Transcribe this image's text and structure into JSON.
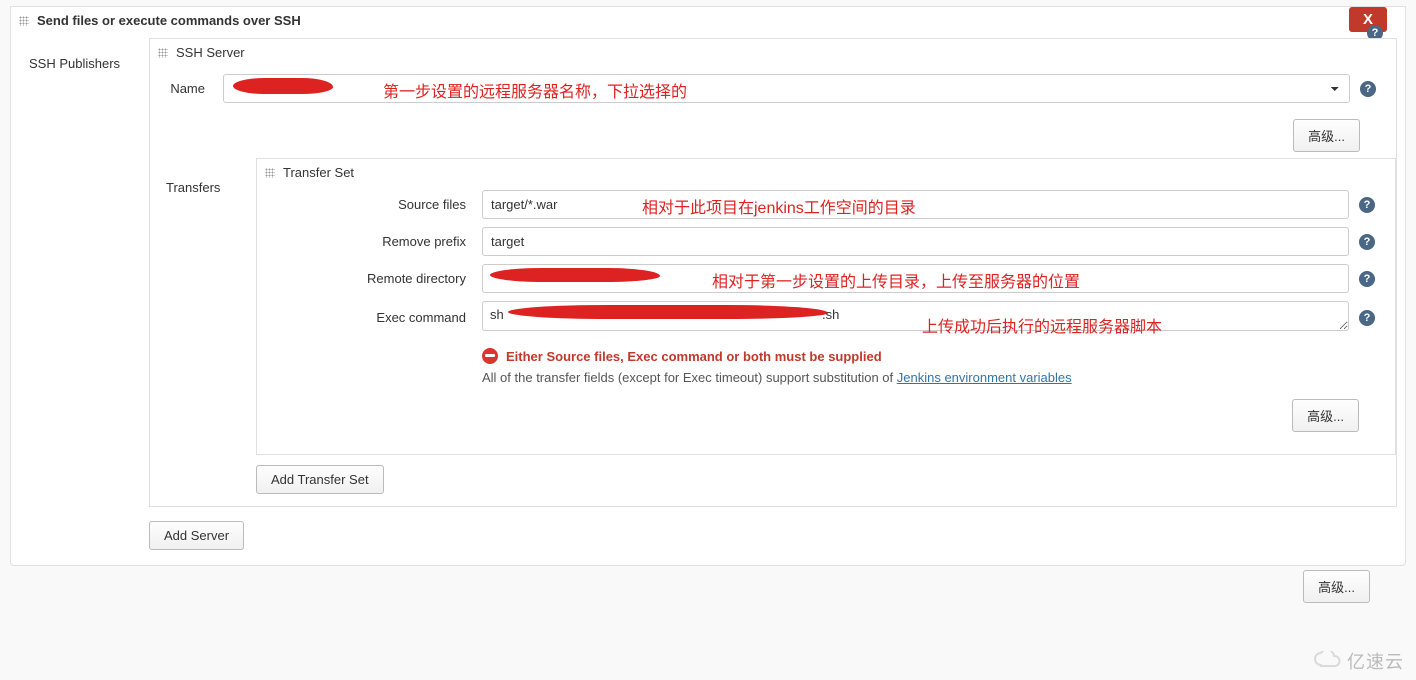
{
  "section": {
    "title": "Send files or execute commands over SSH",
    "delete_label": "X"
  },
  "sidebar_label": "SSH Publishers",
  "ssh_server": {
    "title": "SSH Server",
    "name_label": "Name",
    "name_value": "",
    "advanced_label": "高级..."
  },
  "transfers_label": "Transfers",
  "transfer_set": {
    "title": "Transfer Set",
    "source_label": "Source files",
    "source_value": "target/*.war",
    "remove_prefix_label": "Remove prefix",
    "remove_prefix_value": "target",
    "remote_dir_label": "Remote directory",
    "remote_dir_value": "",
    "exec_label": "Exec command",
    "exec_value_prefix": "sh ",
    "exec_value_suffix": ".sh",
    "error_msg": "Either Source files, Exec command or both must be supplied",
    "note_text": "All of the transfer fields (except for Exec timeout) support substitution of ",
    "note_link": "Jenkins environment variables",
    "advanced_label": "高级..."
  },
  "add_transfer_label": "Add Transfer Set",
  "add_server_label": "Add Server",
  "outer_advanced_label": "高级...",
  "annotations": {
    "name": "第一步设置的远程服务器名称，下拉选择的",
    "source": "相对于此项目在jenkins工作空间的目录",
    "remote": "相对于第一步设置的上传目录，上传至服务器的位置",
    "exec": "上传成功后执行的远程服务器脚本"
  },
  "watermark": "亿速云"
}
